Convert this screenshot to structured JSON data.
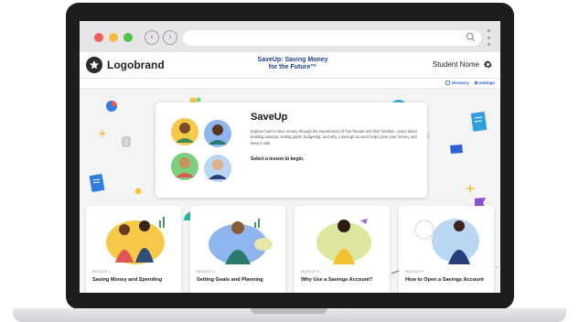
{
  "browser": {
    "back_icon": "‹",
    "forward_icon": "›"
  },
  "header": {
    "logo_text": "Logobrand",
    "title_line1": "SaveUp: Saving Money",
    "title_line2": "for the Future™",
    "student_name": "Student Nome"
  },
  "subnav": {
    "glossary": "Glossary",
    "settings": "settings"
  },
  "intro": {
    "title": "SaveUp",
    "body": "Explore how to save money through the experiences of four friends and their families. Learn about building savings, setting goals, budgeting, and why a savings account helps grow your money and keep it safe.",
    "cta": "Select a lesson to begin."
  },
  "modules": [
    {
      "label": "MODULE 1",
      "title": "Saving Money and Spending",
      "accent": "#f7c948"
    },
    {
      "label": "MODULE 2",
      "title": "Setting Goals and Planning",
      "accent": "#8fb5ee"
    },
    {
      "label": "MODULE 3",
      "title": "Why Use a Savings Account?",
      "accent": "#dfe6a0"
    },
    {
      "label": "MODULE 4",
      "title": "How to Open a Savings Account",
      "accent": "#b9d7f3"
    }
  ],
  "colors": {
    "brand_blue": "#1f3f8c",
    "link_blue": "#2a5bd7"
  }
}
